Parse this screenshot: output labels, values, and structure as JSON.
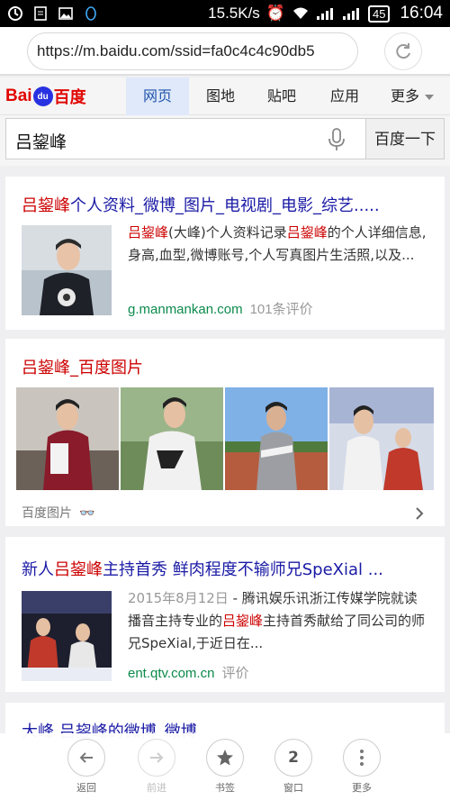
{
  "status": {
    "speed": "15.5K/s",
    "battery": "45",
    "time": "16:04"
  },
  "urlbar": {
    "url": "https://m.baidu.com/ssid=fa0c4c4c90db5"
  },
  "nav": {
    "logo_bai": "Bai",
    "logo_du": "du",
    "logo_cn": "百度",
    "tabs": [
      "网页",
      "图地",
      "贴吧",
      "应用",
      "更多"
    ]
  },
  "search": {
    "query": "吕鋆峰",
    "button": "百度一下"
  },
  "result1": {
    "title_hl": "吕鋆峰",
    "title_rest": "个人资料_微博_图片_电视剧_电影_综艺.....",
    "desc_hl1": "吕鋆峰",
    "desc_a": "(大峰)个人资料记录",
    "desc_hl2": "吕鋆峰",
    "desc_b": "的个人详细信息,身高,血型,微博账号,个人写真图片生活照,以及...",
    "source": "g.manmankan.com",
    "reviews": "101条评价"
  },
  "result2": {
    "title_hl": "吕鋆峰",
    "title_rest": "_百度图片",
    "footer": "百度图片"
  },
  "result3": {
    "title_a": "新人",
    "title_hl": "吕鋆峰",
    "title_b": "主持首秀 鲜肉程度不输师兄SpeXial ...",
    "date": "2015年8月12日",
    "desc_a": " - 腾讯娱乐讯浙江传媒学院就读播音主持专业的",
    "desc_hl": "吕鋆峰",
    "desc_b": "主持首秀献给了同公司的师兄SpeXial,于近日在...",
    "source": "ent.qtv.com.cn",
    "reviews": "评价"
  },
  "result4": {
    "title": "大峰 吕鋆峰的微博_微博"
  },
  "toolbar": {
    "back": "返回",
    "forward": "前进",
    "bookmark": "书签",
    "windows": "窗口",
    "windows_count": "2",
    "more": "更多"
  },
  "colors": {
    "link": "#1a1aa6",
    "highlight": "#cc0000",
    "source": "#0b8a4b",
    "brand_red": "#e10601",
    "brand_blue": "#2932e1"
  }
}
